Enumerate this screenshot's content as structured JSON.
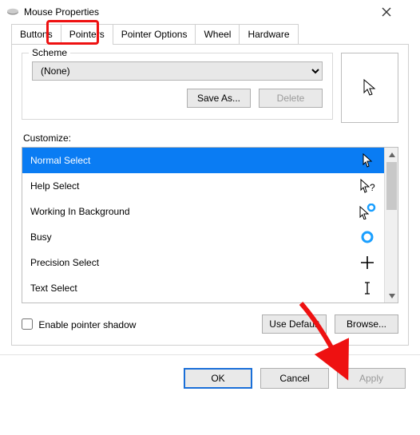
{
  "window": {
    "title": "Mouse Properties"
  },
  "tabs": {
    "items": [
      {
        "label": "Buttons"
      },
      {
        "label": "Pointers"
      },
      {
        "label": "Pointer Options"
      },
      {
        "label": "Wheel"
      },
      {
        "label": "Hardware"
      }
    ],
    "active_index": 1
  },
  "scheme": {
    "group_label": "Scheme",
    "selected": "(None)",
    "save_as": "Save As...",
    "delete": "Delete"
  },
  "customize": {
    "label": "Customize:",
    "items": [
      {
        "label": "Normal Select",
        "icon": "cursor-arrow",
        "selected": true
      },
      {
        "label": "Help Select",
        "icon": "cursor-help",
        "selected": false
      },
      {
        "label": "Working In Background",
        "icon": "cursor-working",
        "selected": false
      },
      {
        "label": "Busy",
        "icon": "cursor-busy",
        "selected": false
      },
      {
        "label": "Precision Select",
        "icon": "cursor-crosshair",
        "selected": false
      },
      {
        "label": "Text Select",
        "icon": "cursor-ibeam",
        "selected": false
      }
    ]
  },
  "shadow": {
    "label": "Enable pointer shadow",
    "checked": false
  },
  "buttons": {
    "use_default": "Use Default",
    "browse": "Browse...",
    "ok": "OK",
    "cancel": "Cancel",
    "apply": "Apply"
  },
  "annotations": {
    "tab_highlight_color": "#e11",
    "arrow_color": "#e11"
  }
}
